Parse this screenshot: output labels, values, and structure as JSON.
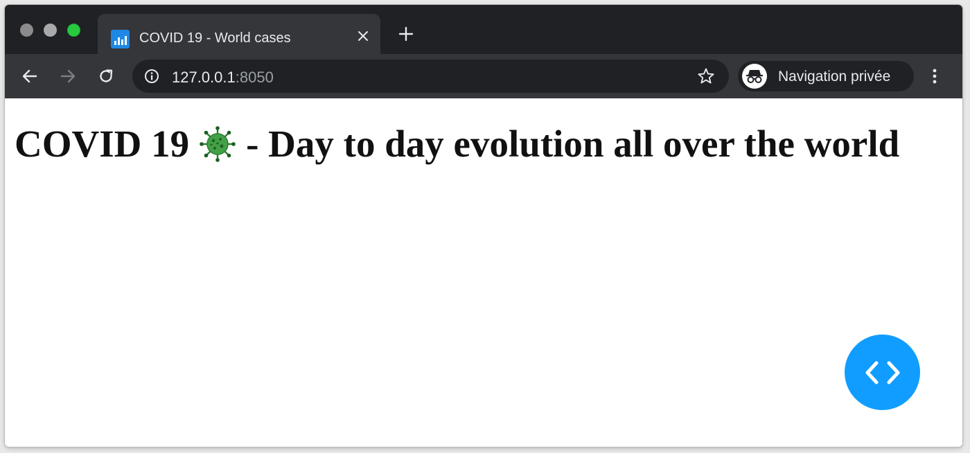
{
  "browser": {
    "tab": {
      "title": "COVID 19 - World cases",
      "favicon": "bar-chart-icon"
    },
    "address_bar": {
      "host": "127.0.0.1",
      "port": ":8050"
    },
    "profile": {
      "label": "Navigation privée",
      "icon": "incognito-icon"
    },
    "icons": {
      "back": "arrow-left-icon",
      "forward": "arrow-right-icon",
      "reload": "reload-icon",
      "info": "info-icon",
      "bookmark": "star-icon",
      "menu": "kebab-menu-icon",
      "new_tab": "plus-icon",
      "close_tab": "close-icon"
    },
    "colors": {
      "titlebar": "#202124",
      "toolbar": "#35363a",
      "text": "#e8eaed",
      "muted_text": "#9aa0a6"
    }
  },
  "page": {
    "title_part1": "COVID 19",
    "title_emoji": "virus-icon",
    "title_part2": "- Day to day evolution all over the world",
    "debug_button": {
      "icon": "code-brackets-icon",
      "color": "#119dff"
    }
  }
}
